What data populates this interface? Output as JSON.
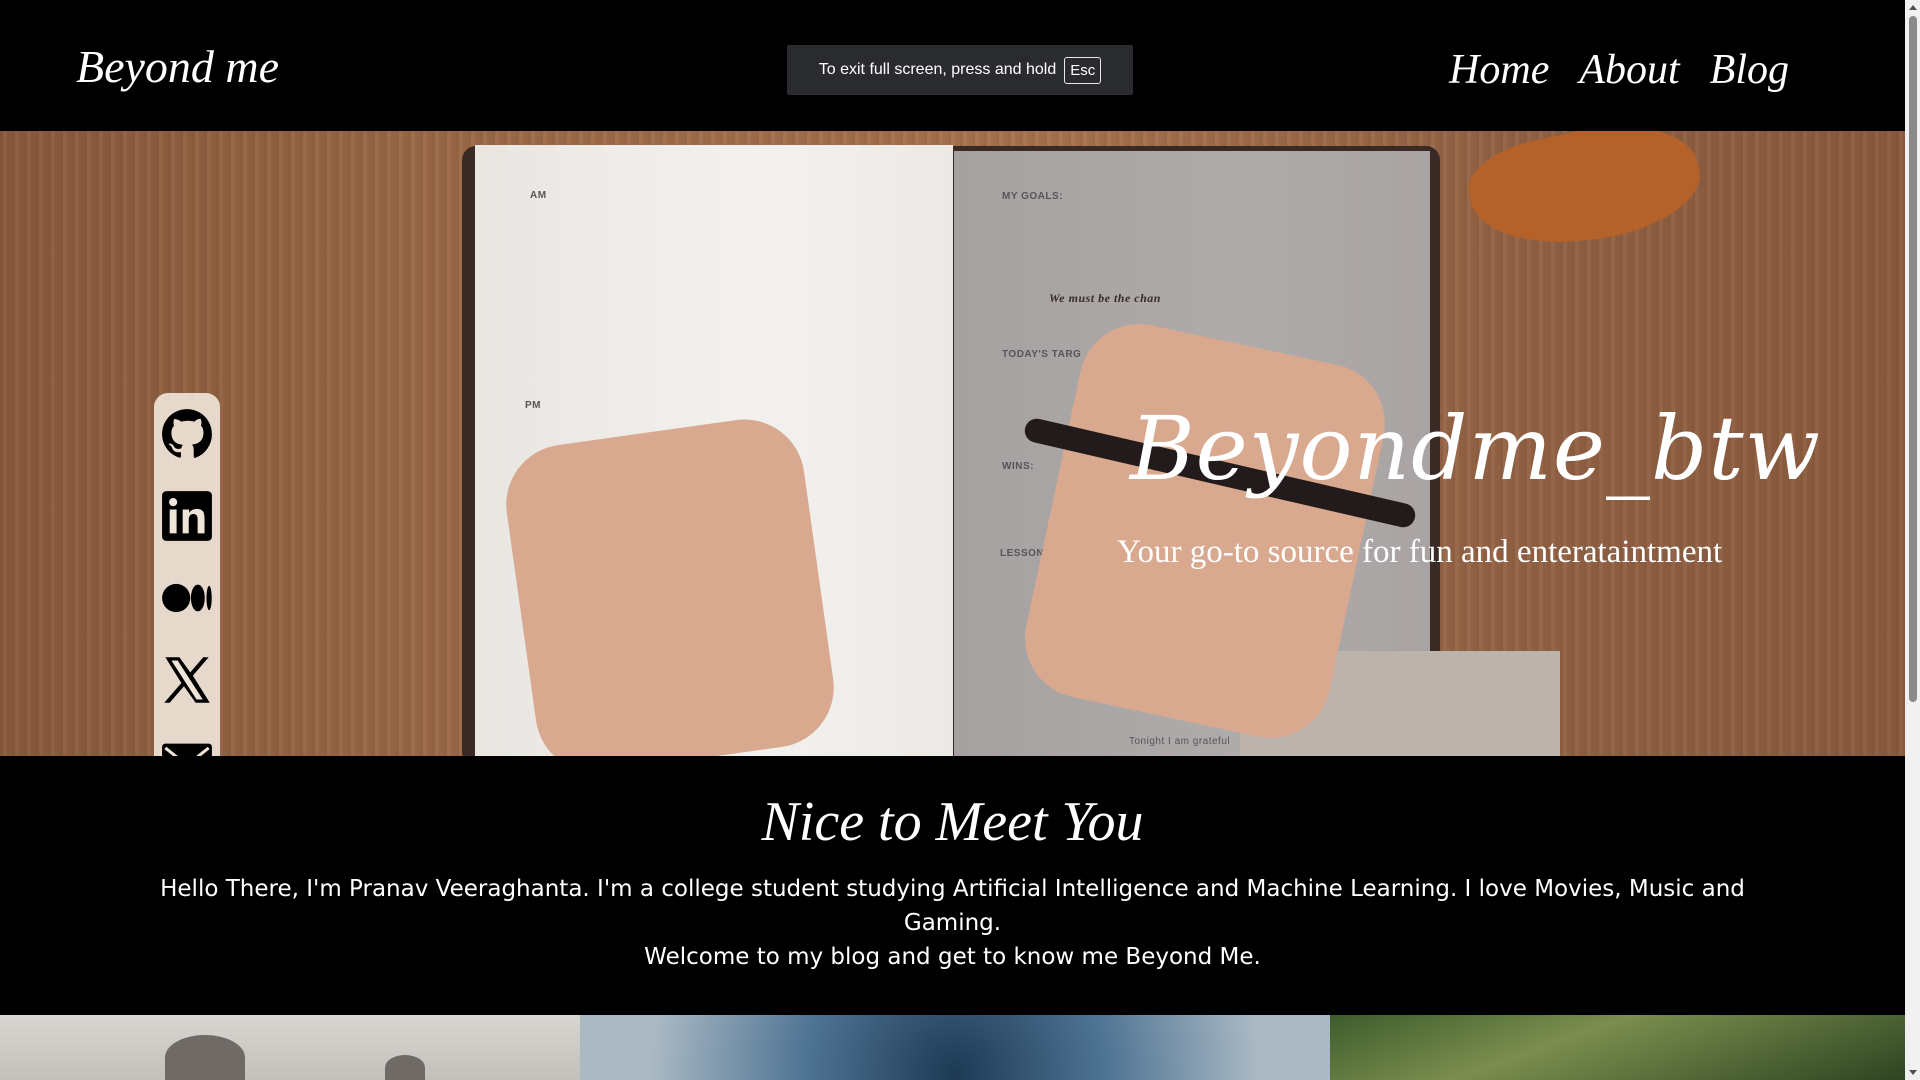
{
  "header": {
    "brand": "Beyond me",
    "nav": [
      {
        "label": "Home"
      },
      {
        "label": "About"
      },
      {
        "label": "Blog"
      }
    ]
  },
  "fullscreen_notice": {
    "text": "To exit full screen, press and hold",
    "key": "Esc"
  },
  "hero": {
    "title": "Beyondme_btw",
    "subtitle": "Your go-to source for fun and enterataintment",
    "planner_labels": {
      "goals": "MY GOALS:",
      "quote": "We must be the chan",
      "targets": "TODAY'S TARG",
      "wins": "WINS:",
      "lessons": "LESSONS LEARNED:",
      "grateful": "Tonight I am grateful",
      "am": "AM",
      "pm": "PM"
    }
  },
  "social": [
    {
      "icon": "github-icon"
    },
    {
      "icon": "linkedin-icon"
    },
    {
      "icon": "medium-icon"
    },
    {
      "icon": "x-twitter-icon"
    },
    {
      "icon": "mail-icon"
    }
  ],
  "intro": {
    "title": "Nice to Meet You",
    "line1": "Hello There, I'm Pranav Veeraghanta. I'm a college student studying Artificial Intelligence and Machine Learning. I love Movies, Music and Gaming.",
    "line2": "Welcome to my blog and get to know me Beyond Me."
  },
  "colors": {
    "background": "#000000",
    "wood": "#9c6a48",
    "social_bar": "#eee4d8"
  }
}
